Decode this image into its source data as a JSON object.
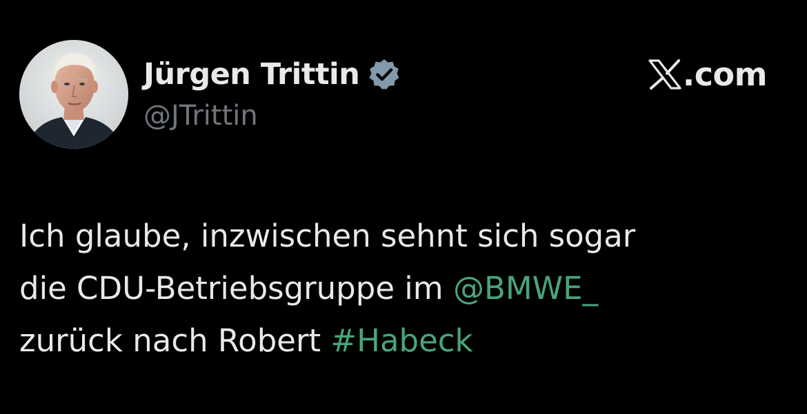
{
  "author": {
    "display_name": "Jürgen Trittin",
    "handle": "@JTrittin",
    "verified_icon": "verified-badge-icon"
  },
  "site": {
    "logo_icon": "x-logo-icon",
    "domain": ".com"
  },
  "tweet": {
    "line1": "Ich glaube, inzwischen sehnt sich sogar",
    "line2_text": "die CDU-Betriebsgruppe im ",
    "mention": "@BMWE_",
    "line3_text": "zurück nach Robert ",
    "hashtag": "#Habeck"
  },
  "colors": {
    "background": "#000000",
    "text": "#e7e9ea",
    "secondary_text": "#71767b",
    "link": "#4aa57a",
    "verified_badge": "#829aab"
  }
}
